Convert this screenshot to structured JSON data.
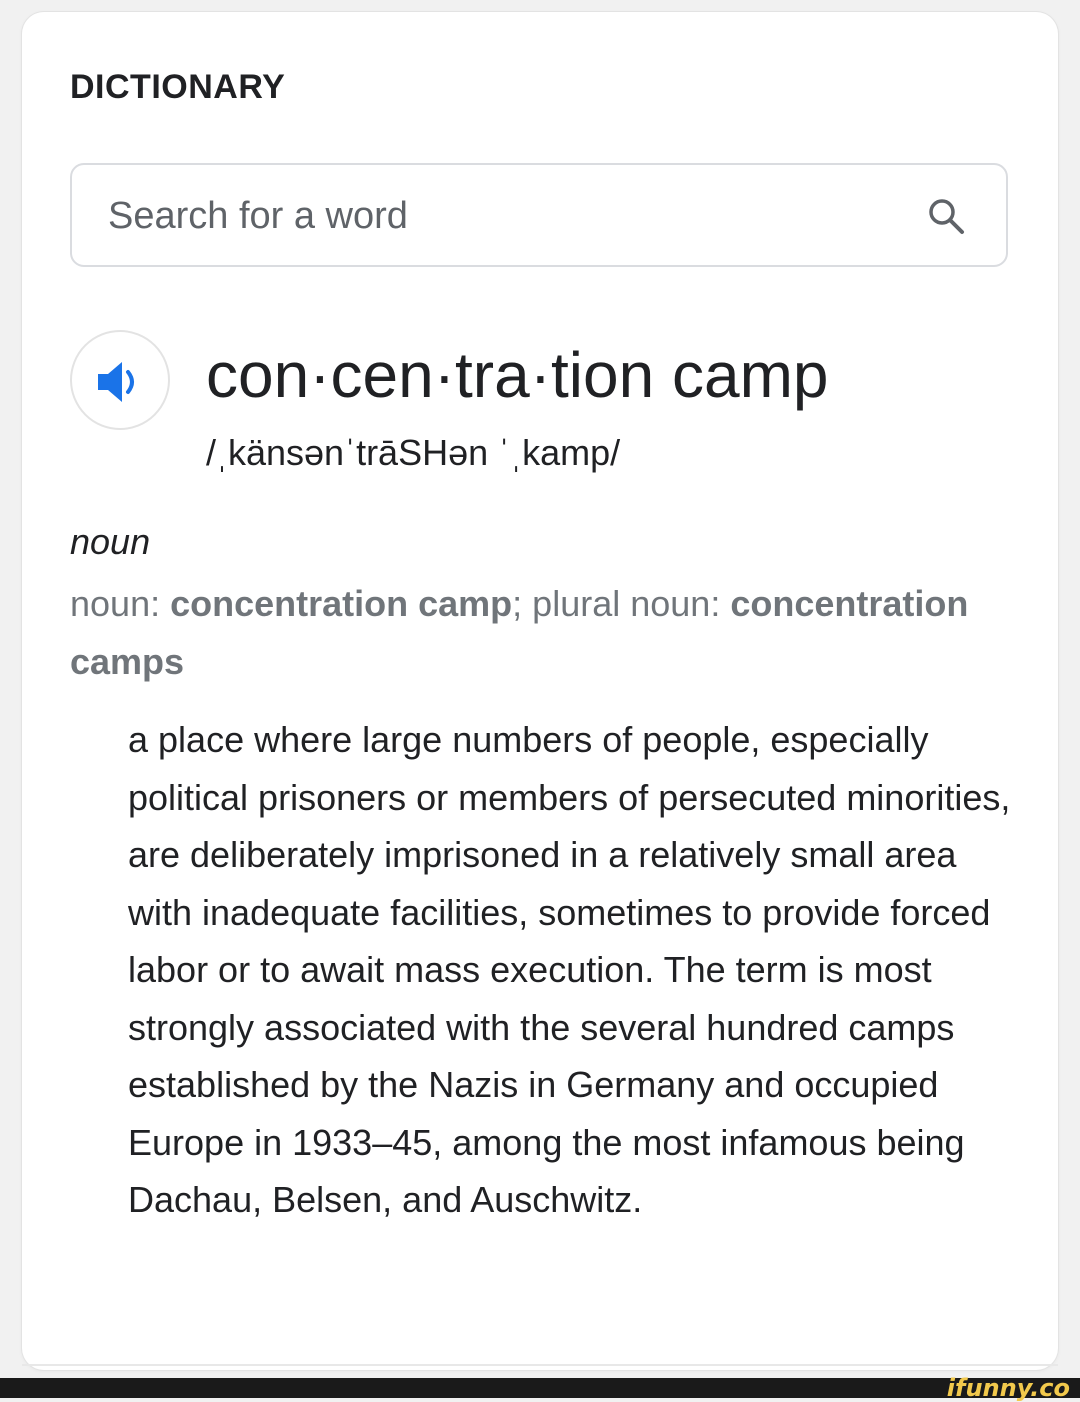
{
  "section_heading": "DICTIONARY",
  "search": {
    "placeholder": "Search for a word",
    "icon": "search-icon"
  },
  "entry": {
    "pronounce_icon": "speaker-icon",
    "word": "con·cen·tra·tion camp",
    "phonetic": "/ˌkänsənˈtrāSHən ˈˌkamp/",
    "part_of_speech": "noun",
    "forms": {
      "noun_label": "noun: ",
      "noun_value": "concentration camp",
      "plural_label": "; plural noun: ",
      "plural_value": "concentration camps"
    },
    "definition": "a place where large numbers of people, especially political prisoners or members of persecuted minorities, are deliberately imprisoned in a relatively small area with inadequate facilities, sometimes to provide forced labor or to await mass execution. The term is most strongly associated with the several hundred camps established by the Nazis in Germany and occupied Europe in 1933–45, among the most infamous being Dachau, Belsen, and Auschwitz."
  },
  "watermark": "ifunny.co",
  "colors": {
    "accent_blue": "#1a73e8",
    "secondary_text": "#70757a",
    "primary_text": "#202124"
  }
}
